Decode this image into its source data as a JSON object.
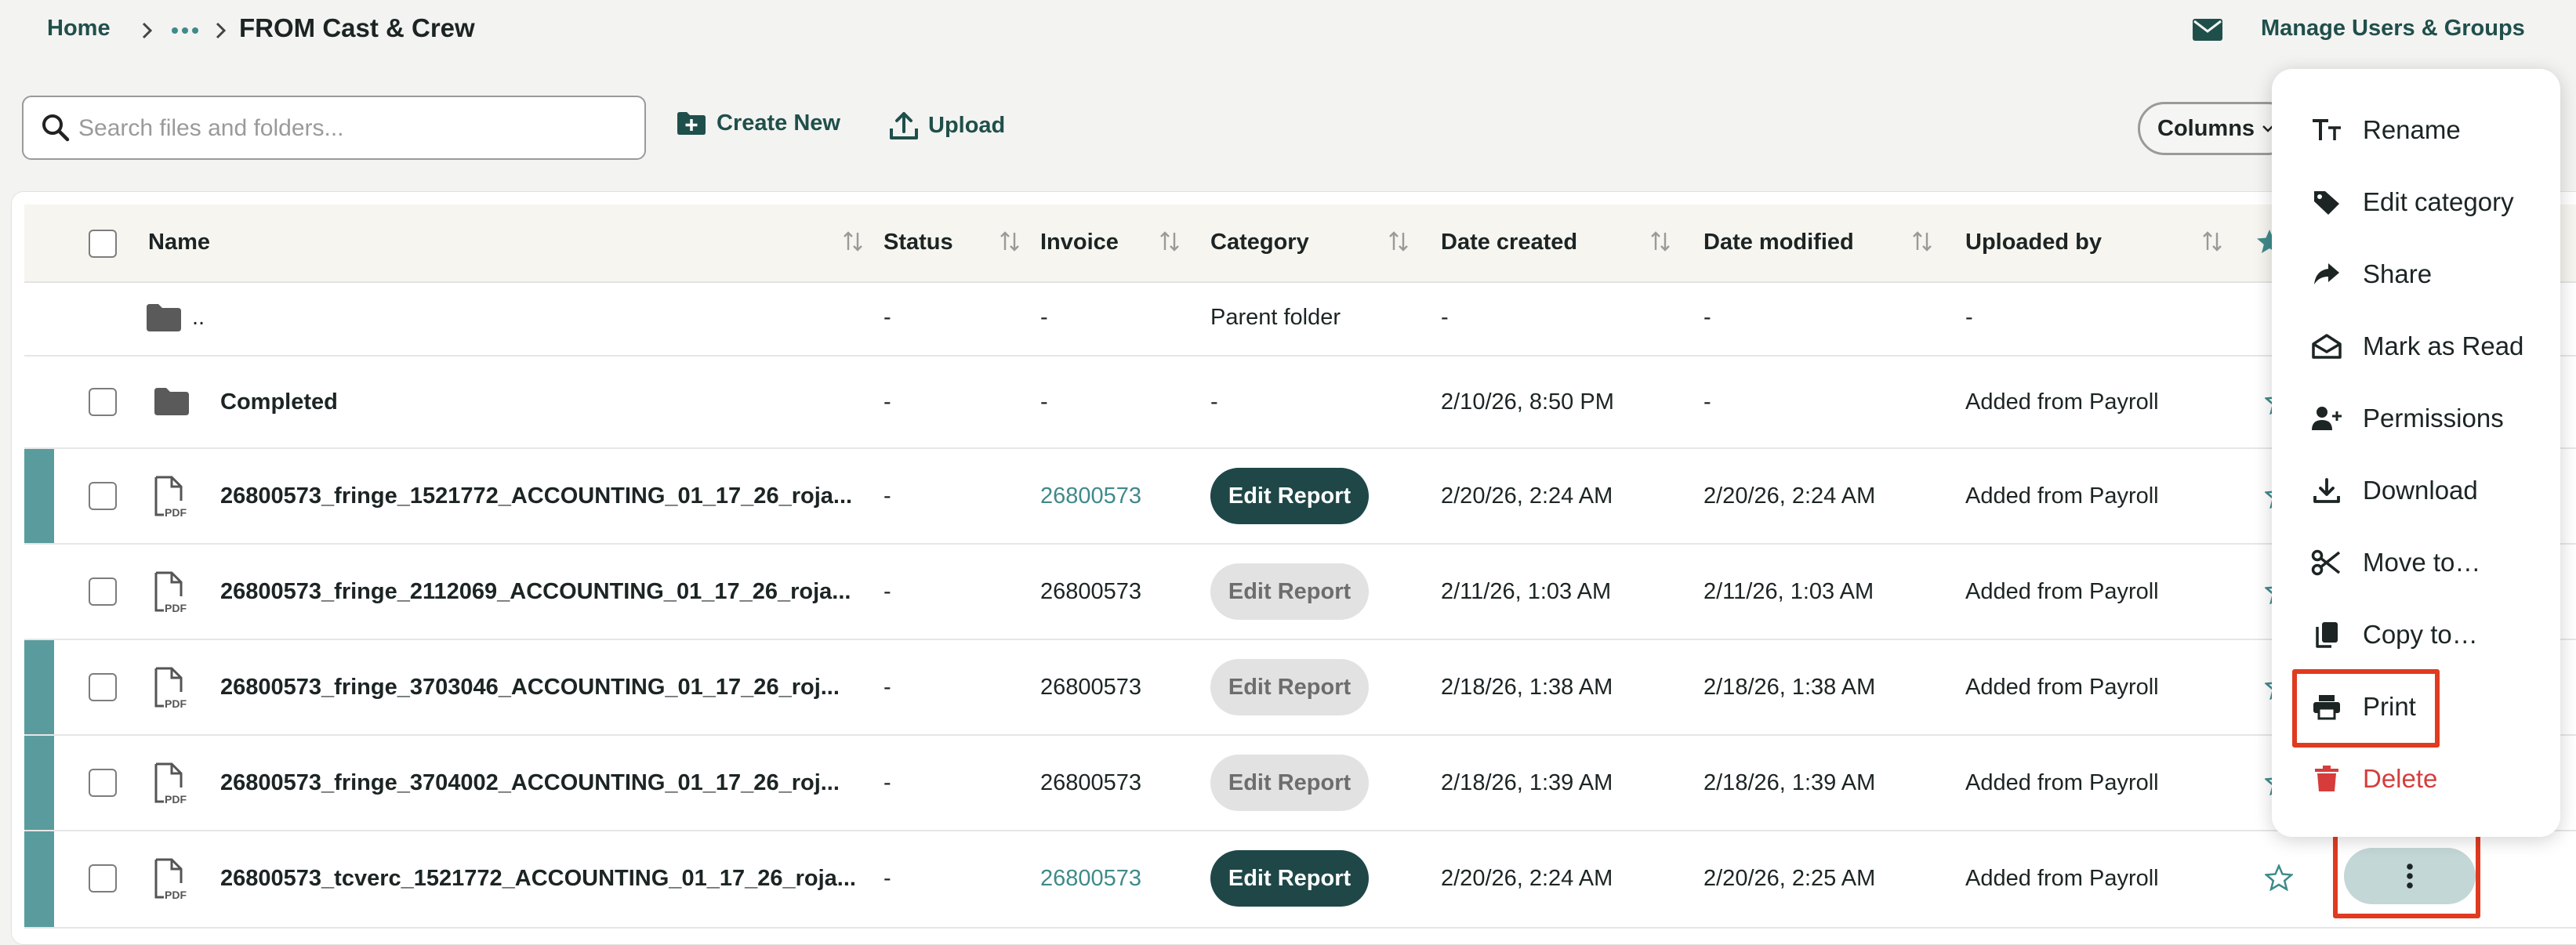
{
  "breadcrumb": {
    "home": "Home",
    "current": "FROM Cast & Crew"
  },
  "header": {
    "manage_link": "Manage Users & Groups"
  },
  "toolbar": {
    "search_placeholder": "Search files and folders...",
    "create_new": "Create New",
    "upload": "Upload",
    "columns": "Columns"
  },
  "table": {
    "headers": {
      "name": "Name",
      "status": "Status",
      "invoice": "Invoice",
      "category": "Category",
      "date_created": "Date created",
      "date_modified": "Date modified",
      "uploaded_by": "Uploaded by"
    },
    "parent_row": {
      "name": "..",
      "status": "-",
      "invoice": "-",
      "category": "Parent folder",
      "date_created": "-",
      "date_modified": "-",
      "uploaded_by": "-"
    },
    "rows": [
      {
        "name": "Completed",
        "type": "folder",
        "status": "-",
        "invoice": "-",
        "category": "-",
        "date_created": "2/10/26, 8:50 PM",
        "date_modified": "-",
        "uploaded_by": "Added from Payroll"
      },
      {
        "name": "26800573_fringe_1521772_ACCOUNTING_01_17_26_roja...",
        "type": "pdf",
        "status": "-",
        "invoice": "26800573",
        "category_button": "Edit Report",
        "date_created": "2/20/26, 2:24 AM",
        "date_modified": "2/20/26, 2:24 AM",
        "uploaded_by": "Added from Payroll"
      },
      {
        "name": "26800573_fringe_2112069_ACCOUNTING_01_17_26_roja...",
        "type": "pdf",
        "status": "-",
        "invoice": "26800573",
        "category_button": "Edit Report",
        "date_created": "2/11/26, 1:03 AM",
        "date_modified": "2/11/26, 1:03 AM",
        "uploaded_by": "Added from Payroll"
      },
      {
        "name": "26800573_fringe_3703046_ACCOUNTING_01_17_26_roj...",
        "type": "pdf",
        "status": "-",
        "invoice": "26800573",
        "category_button": "Edit Report",
        "date_created": "2/18/26, 1:38 AM",
        "date_modified": "2/18/26, 1:38 AM",
        "uploaded_by": "Added from Payroll"
      },
      {
        "name": "26800573_fringe_3704002_ACCOUNTING_01_17_26_roj...",
        "type": "pdf",
        "status": "-",
        "invoice": "26800573",
        "category_button": "Edit Report",
        "date_created": "2/18/26, 1:39 AM",
        "date_modified": "2/18/26, 1:39 AM",
        "uploaded_by": "Added from Payroll"
      },
      {
        "name": "26800573_tcverc_1521772_ACCOUNTING_01_17_26_roja...",
        "type": "pdf",
        "status": "-",
        "invoice": "26800573",
        "category_button": "Edit Report",
        "date_created": "2/20/26, 2:24 AM",
        "date_modified": "2/20/26, 2:25 AM",
        "uploaded_by": "Added from Payroll"
      }
    ]
  },
  "context_menu": {
    "items": [
      {
        "label": "Rename",
        "icon": "text-format-icon"
      },
      {
        "label": "Edit category",
        "icon": "tag-icon"
      },
      {
        "label": "Share",
        "icon": "share-arrow-icon"
      },
      {
        "label": "Mark as Read",
        "icon": "open-envelope-icon"
      },
      {
        "label": "Permissions",
        "icon": "user-plus-icon"
      },
      {
        "label": "Download",
        "icon": "download-icon"
      },
      {
        "label": "Move to…",
        "icon": "scissors-icon"
      },
      {
        "label": "Copy to…",
        "icon": "copy-icon"
      },
      {
        "label": "Print",
        "icon": "printer-icon"
      },
      {
        "label": "Delete",
        "icon": "trash-icon"
      }
    ]
  },
  "colors": {
    "accent": "#1f4f4b",
    "link": "#3f8a8a",
    "danger": "#d63c3c",
    "highlight": "#e03a20",
    "row_accent": "#5a9c9d"
  }
}
